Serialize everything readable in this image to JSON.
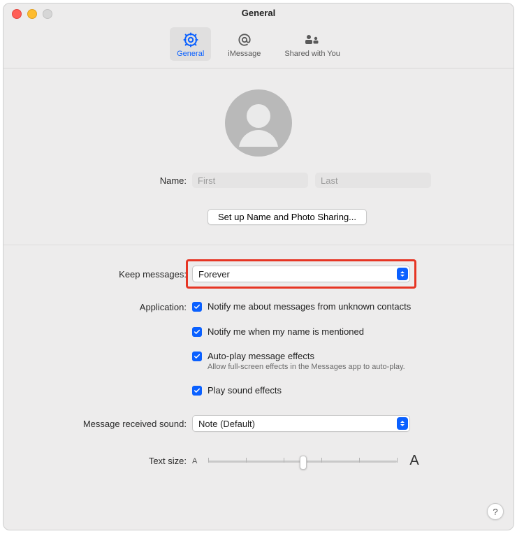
{
  "window": {
    "title": "General"
  },
  "toolbar": {
    "tabs": [
      {
        "label": "General",
        "icon": "gear"
      },
      {
        "label": "iMessage",
        "icon": "at"
      },
      {
        "label": "Shared with You",
        "icon": "people"
      }
    ]
  },
  "profile": {
    "name_label": "Name:",
    "first_placeholder": "First",
    "last_placeholder": "Last",
    "setup_button": "Set up Name and Photo Sharing..."
  },
  "keep": {
    "label": "Keep messages:",
    "value": "Forever"
  },
  "application": {
    "label": "Application:",
    "opt_unknown": "Notify me about messages from unknown contacts",
    "opt_mentioned": "Notify me when my name is mentioned",
    "opt_autoplay": "Auto-play message effects",
    "opt_autoplay_sub": "Allow full-screen effects in the Messages app to auto-play.",
    "opt_sound": "Play sound effects"
  },
  "sound": {
    "label": "Message received sound:",
    "value": "Note (Default)"
  },
  "textsize": {
    "label": "Text size:",
    "small_marker": "A",
    "large_marker": "A"
  },
  "help_marker": "?"
}
